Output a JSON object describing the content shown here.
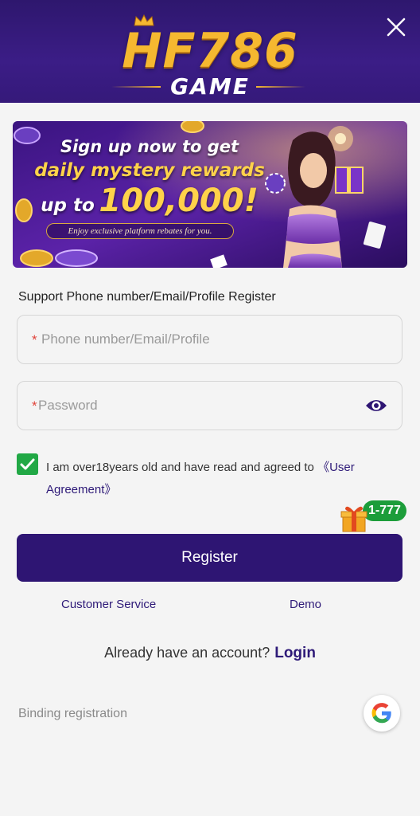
{
  "header": {
    "logo_main": "HF786",
    "logo_sub": "GAME"
  },
  "banner": {
    "line1": "Sign up now to get",
    "line2": "daily mystery rewards",
    "line3_prefix": "up to",
    "line3_amount": "100,000!",
    "note": "Enjoy exclusive platform rebates for you."
  },
  "form": {
    "label": "Support Phone number/Email/Profile Register",
    "phone_required_mark": "*",
    "phone_placeholder": "Phone number/Email/Profile",
    "password_required_mark": "*",
    "password_placeholder": "Password",
    "agree_text": "I am over18years old and have read and agreed to ",
    "agree_link": "《User Agreement》",
    "agree_checked": true
  },
  "gift": {
    "badge": "1-777"
  },
  "actions": {
    "register_label": "Register",
    "customer_service": "Customer Service",
    "demo": "Demo",
    "already_text": "Already have an account?",
    "login_label": "Login",
    "binding_label": "Binding registration"
  },
  "icons": {
    "close": "close-icon",
    "eye": "eye-icon",
    "check": "check-icon",
    "gift": "gift-icon",
    "google": "google-icon",
    "crown": "crown-icon"
  },
  "colors": {
    "header_bg": "#3b1d86",
    "primary": "#2e1573",
    "link": "#2e1a78",
    "gold": "#f5b830",
    "checkbox": "#21a845",
    "required": "#e0433a"
  }
}
